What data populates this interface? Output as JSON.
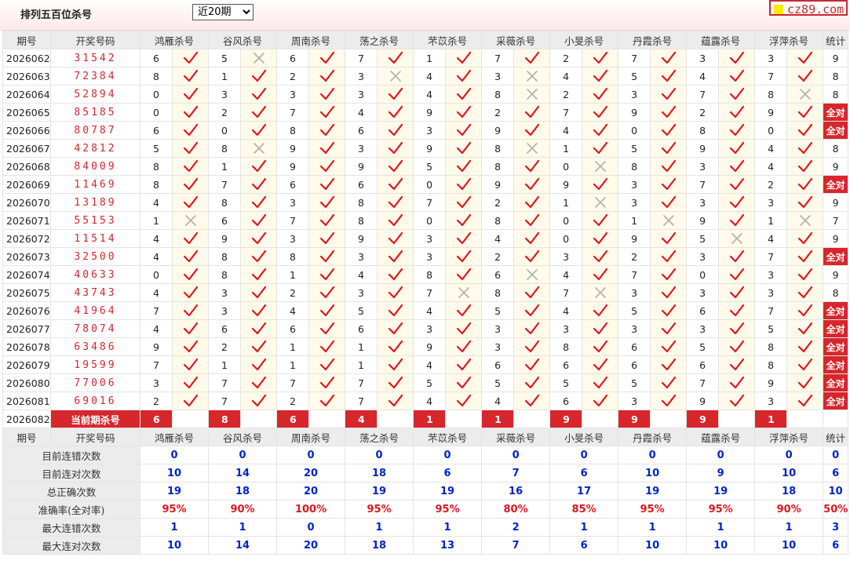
{
  "header": {
    "title": "排列五百位杀号",
    "period_select": {
      "selected": "近20期",
      "options": [
        "近20期"
      ]
    },
    "logo_text": "cz89.com"
  },
  "columns": {
    "issue": "期号",
    "draw": "开奖号码",
    "experts": [
      "鸿雁杀号",
      "谷风杀号",
      "周南杀号",
      "荡之杀号",
      "芣苡杀号",
      "采薇杀号",
      "小旻杀号",
      "丹霞杀号",
      "蕴露杀号",
      "浮萍杀号"
    ],
    "stat": "统计"
  },
  "rows": [
    {
      "issue": "2026062",
      "draw": "31542",
      "kills": [
        [
          6,
          1
        ],
        [
          5,
          0
        ],
        [
          6,
          1
        ],
        [
          7,
          1
        ],
        [
          1,
          1
        ],
        [
          7,
          1
        ],
        [
          2,
          1
        ],
        [
          7,
          1
        ],
        [
          3,
          1
        ],
        [
          3,
          1
        ]
      ],
      "stat": "9"
    },
    {
      "issue": "2026063",
      "draw": "72384",
      "kills": [
        [
          8,
          1
        ],
        [
          1,
          1
        ],
        [
          2,
          1
        ],
        [
          3,
          0
        ],
        [
          4,
          1
        ],
        [
          3,
          0
        ],
        [
          4,
          1
        ],
        [
          5,
          1
        ],
        [
          4,
          1
        ],
        [
          7,
          1
        ]
      ],
      "stat": "8"
    },
    {
      "issue": "2026064",
      "draw": "52894",
      "kills": [
        [
          0,
          1
        ],
        [
          3,
          1
        ],
        [
          3,
          1
        ],
        [
          3,
          1
        ],
        [
          4,
          1
        ],
        [
          8,
          0
        ],
        [
          2,
          1
        ],
        [
          3,
          1
        ],
        [
          7,
          1
        ],
        [
          8,
          0
        ]
      ],
      "stat": "8"
    },
    {
      "issue": "2026065",
      "draw": "85185",
      "kills": [
        [
          0,
          1
        ],
        [
          2,
          1
        ],
        [
          7,
          1
        ],
        [
          4,
          1
        ],
        [
          9,
          1
        ],
        [
          2,
          1
        ],
        [
          7,
          1
        ],
        [
          9,
          1
        ],
        [
          2,
          1
        ],
        [
          9,
          1
        ]
      ],
      "stat": "全对"
    },
    {
      "issue": "2026066",
      "draw": "80787",
      "kills": [
        [
          6,
          1
        ],
        [
          0,
          1
        ],
        [
          8,
          1
        ],
        [
          6,
          1
        ],
        [
          3,
          1
        ],
        [
          9,
          1
        ],
        [
          4,
          1
        ],
        [
          0,
          1
        ],
        [
          8,
          1
        ],
        [
          0,
          1
        ]
      ],
      "stat": "全对"
    },
    {
      "issue": "2026067",
      "draw": "42812",
      "kills": [
        [
          5,
          1
        ],
        [
          8,
          0
        ],
        [
          9,
          1
        ],
        [
          3,
          1
        ],
        [
          9,
          1
        ],
        [
          8,
          0
        ],
        [
          1,
          1
        ],
        [
          5,
          1
        ],
        [
          9,
          1
        ],
        [
          4,
          1
        ]
      ],
      "stat": "8"
    },
    {
      "issue": "2026068",
      "draw": "84009",
      "kills": [
        [
          8,
          1
        ],
        [
          1,
          1
        ],
        [
          9,
          1
        ],
        [
          9,
          1
        ],
        [
          5,
          1
        ],
        [
          8,
          1
        ],
        [
          0,
          0
        ],
        [
          8,
          1
        ],
        [
          3,
          1
        ],
        [
          4,
          1
        ]
      ],
      "stat": "9"
    },
    {
      "issue": "2026069",
      "draw": "11469",
      "kills": [
        [
          8,
          1
        ],
        [
          7,
          1
        ],
        [
          6,
          1
        ],
        [
          6,
          1
        ],
        [
          0,
          1
        ],
        [
          9,
          1
        ],
        [
          9,
          1
        ],
        [
          3,
          1
        ],
        [
          7,
          1
        ],
        [
          2,
          1
        ]
      ],
      "stat": "全对"
    },
    {
      "issue": "2026070",
      "draw": "13189",
      "kills": [
        [
          4,
          1
        ],
        [
          8,
          1
        ],
        [
          3,
          1
        ],
        [
          8,
          1
        ],
        [
          7,
          1
        ],
        [
          2,
          1
        ],
        [
          1,
          0
        ],
        [
          3,
          1
        ],
        [
          3,
          1
        ],
        [
          3,
          1
        ]
      ],
      "stat": "9"
    },
    {
      "issue": "2026071",
      "draw": "55153",
      "kills": [
        [
          1,
          0
        ],
        [
          6,
          1
        ],
        [
          7,
          1
        ],
        [
          8,
          1
        ],
        [
          0,
          1
        ],
        [
          8,
          1
        ],
        [
          0,
          1
        ],
        [
          1,
          0
        ],
        [
          9,
          1
        ],
        [
          1,
          0
        ]
      ],
      "stat": "7"
    },
    {
      "issue": "2026072",
      "draw": "11514",
      "kills": [
        [
          4,
          1
        ],
        [
          9,
          1
        ],
        [
          3,
          1
        ],
        [
          9,
          1
        ],
        [
          3,
          1
        ],
        [
          4,
          1
        ],
        [
          0,
          1
        ],
        [
          9,
          1
        ],
        [
          5,
          0
        ],
        [
          4,
          1
        ]
      ],
      "stat": "9"
    },
    {
      "issue": "2026073",
      "draw": "32500",
      "kills": [
        [
          4,
          1
        ],
        [
          8,
          1
        ],
        [
          8,
          1
        ],
        [
          3,
          1
        ],
        [
          3,
          1
        ],
        [
          2,
          1
        ],
        [
          3,
          1
        ],
        [
          2,
          1
        ],
        [
          3,
          1
        ],
        [
          7,
          1
        ]
      ],
      "stat": "全对"
    },
    {
      "issue": "2026074",
      "draw": "40633",
      "kills": [
        [
          0,
          1
        ],
        [
          8,
          1
        ],
        [
          1,
          1
        ],
        [
          4,
          1
        ],
        [
          8,
          1
        ],
        [
          6,
          0
        ],
        [
          4,
          1
        ],
        [
          7,
          1
        ],
        [
          0,
          1
        ],
        [
          3,
          1
        ]
      ],
      "stat": "9"
    },
    {
      "issue": "2026075",
      "draw": "43743",
      "kills": [
        [
          4,
          1
        ],
        [
          3,
          1
        ],
        [
          2,
          1
        ],
        [
          3,
          1
        ],
        [
          7,
          0
        ],
        [
          8,
          1
        ],
        [
          7,
          0
        ],
        [
          3,
          1
        ],
        [
          3,
          1
        ],
        [
          3,
          1
        ]
      ],
      "stat": "8"
    },
    {
      "issue": "2026076",
      "draw": "41964",
      "kills": [
        [
          7,
          1
        ],
        [
          3,
          1
        ],
        [
          4,
          1
        ],
        [
          5,
          1
        ],
        [
          4,
          1
        ],
        [
          5,
          1
        ],
        [
          4,
          1
        ],
        [
          5,
          1
        ],
        [
          6,
          1
        ],
        [
          7,
          1
        ]
      ],
      "stat": "全对"
    },
    {
      "issue": "2026077",
      "draw": "78074",
      "kills": [
        [
          4,
          1
        ],
        [
          6,
          1
        ],
        [
          6,
          1
        ],
        [
          6,
          1
        ],
        [
          3,
          1
        ],
        [
          3,
          1
        ],
        [
          3,
          1
        ],
        [
          3,
          1
        ],
        [
          3,
          1
        ],
        [
          5,
          1
        ]
      ],
      "stat": "全对"
    },
    {
      "issue": "2026078",
      "draw": "63486",
      "kills": [
        [
          9,
          1
        ],
        [
          2,
          1
        ],
        [
          1,
          1
        ],
        [
          1,
          1
        ],
        [
          9,
          1
        ],
        [
          3,
          1
        ],
        [
          8,
          1
        ],
        [
          6,
          1
        ],
        [
          5,
          1
        ],
        [
          8,
          1
        ]
      ],
      "stat": "全对"
    },
    {
      "issue": "2026079",
      "draw": "19599",
      "kills": [
        [
          7,
          1
        ],
        [
          1,
          1
        ],
        [
          1,
          1
        ],
        [
          1,
          1
        ],
        [
          4,
          1
        ],
        [
          6,
          1
        ],
        [
          6,
          1
        ],
        [
          6,
          1
        ],
        [
          6,
          1
        ],
        [
          8,
          1
        ]
      ],
      "stat": "全对"
    },
    {
      "issue": "2026080",
      "draw": "77006",
      "kills": [
        [
          3,
          1
        ],
        [
          7,
          1
        ],
        [
          7,
          1
        ],
        [
          7,
          1
        ],
        [
          5,
          1
        ],
        [
          5,
          1
        ],
        [
          5,
          1
        ],
        [
          5,
          1
        ],
        [
          7,
          1
        ],
        [
          9,
          1
        ]
      ],
      "stat": "全对"
    },
    {
      "issue": "2026081",
      "draw": "69016",
      "kills": [
        [
          2,
          1
        ],
        [
          7,
          1
        ],
        [
          2,
          1
        ],
        [
          7,
          1
        ],
        [
          4,
          1
        ],
        [
          4,
          1
        ],
        [
          6,
          1
        ],
        [
          3,
          1
        ],
        [
          9,
          1
        ],
        [
          3,
          1
        ]
      ],
      "stat": "全对"
    }
  ],
  "current": {
    "issue": "2026082",
    "label": "当前期杀号",
    "kills": [
      "6",
      "8",
      "6",
      "4",
      "1",
      "1",
      "9",
      "9",
      "9",
      "1"
    ]
  },
  "summary": [
    {
      "label": "目前连错次数",
      "values": [
        "0",
        "0",
        "0",
        "0",
        "0",
        "0",
        "0",
        "0",
        "0",
        "0",
        "0"
      ]
    },
    {
      "label": "目前连对次数",
      "values": [
        "10",
        "14",
        "20",
        "18",
        "6",
        "7",
        "6",
        "10",
        "9",
        "10",
        "6"
      ]
    },
    {
      "label": "总正确次数",
      "values": [
        "19",
        "18",
        "20",
        "19",
        "19",
        "16",
        "17",
        "19",
        "19",
        "18",
        "10"
      ]
    },
    {
      "label": "准确率(全对率)",
      "values": [
        "95%",
        "90%",
        "100%",
        "95%",
        "95%",
        "80%",
        "85%",
        "95%",
        "95%",
        "90%",
        "50%"
      ],
      "red": true
    },
    {
      "label": "最大连错次数",
      "values": [
        "1",
        "1",
        "0",
        "1",
        "1",
        "2",
        "1",
        "1",
        "1",
        "1",
        "3"
      ]
    },
    {
      "label": "最大连对次数",
      "values": [
        "10",
        "14",
        "20",
        "18",
        "13",
        "7",
        "6",
        "10",
        "10",
        "10",
        "6"
      ]
    }
  ],
  "colors": {
    "accent": "#d7262c",
    "check": "#e0161c",
    "cross": "#b0b0b0",
    "summary_value": "#0022cc",
    "mark_bg": "#fffae9"
  },
  "icons": {
    "hit": "check-icon",
    "miss": "cross-icon"
  }
}
